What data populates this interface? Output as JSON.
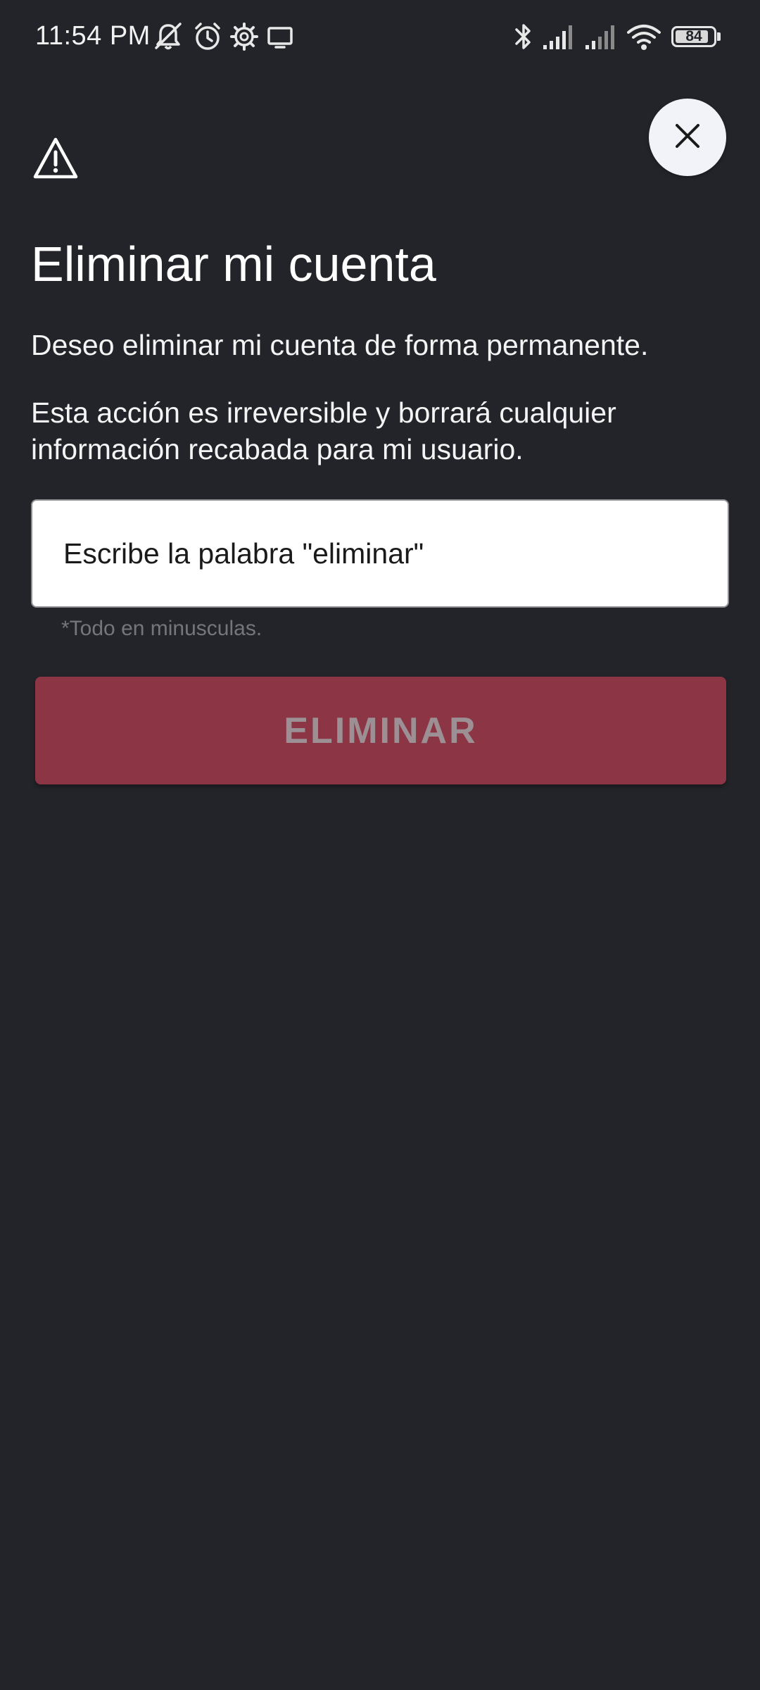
{
  "status_bar": {
    "time": "11:54 PM",
    "battery_level": "84",
    "icons": [
      "bell-off-icon",
      "alarm-icon",
      "settings-gear-icon",
      "screen-cast-icon",
      "bluetooth-icon",
      "signal-icon",
      "signal-icon",
      "wifi-icon",
      "battery-icon"
    ]
  },
  "dialog": {
    "close_icon": "close-icon",
    "warning_icon": "warning-icon",
    "title": "Eliminar mi cuenta",
    "description_1": "Deseo eliminar mi cuenta de forma permanente.",
    "description_2": "Esta acción es irreversible y borrará cualquier información recabada para mi usuario.",
    "input_placeholder": "Escribe la palabra \"eliminar\"",
    "input_value": "",
    "helper_text": "*Todo en minusculas.",
    "delete_button_label": "ELIMINAR"
  },
  "colors": {
    "background": "#232429",
    "delete_button": "#8c3645",
    "delete_button_text": "#9d9095",
    "close_button_bg": "#f2f3f8"
  }
}
